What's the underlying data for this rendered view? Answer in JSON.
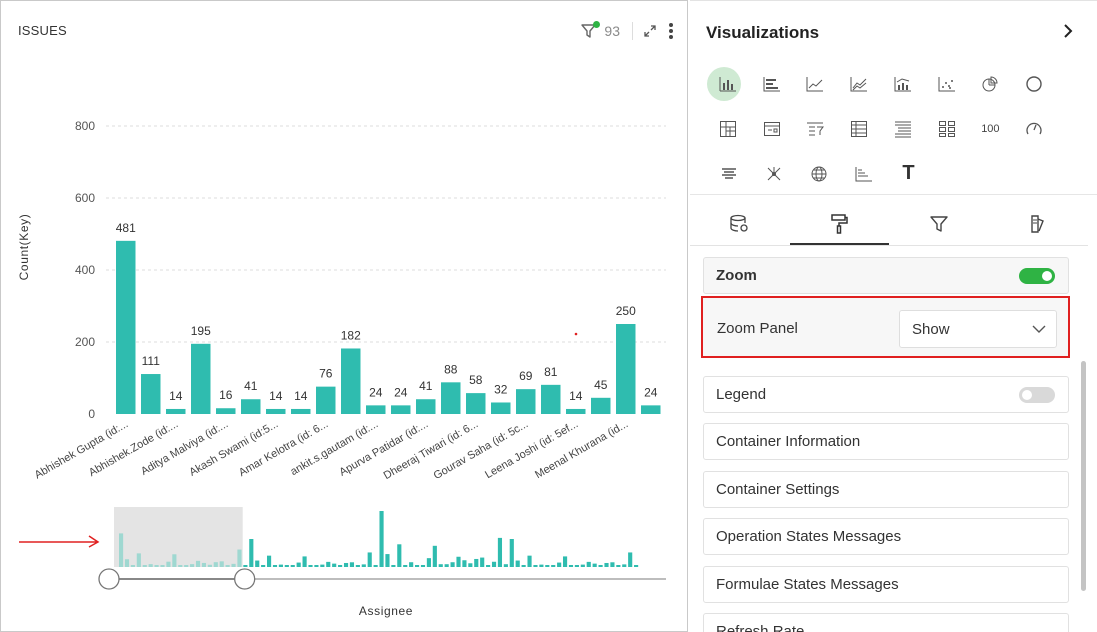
{
  "chart_panel": {
    "title": "ISSUES",
    "filter_count": "93"
  },
  "chart_data": {
    "type": "bar",
    "xlabel": "Assignee",
    "ylabel": "Count(Key)",
    "ylim": [
      0,
      800
    ],
    "yticks": [
      0,
      200,
      400,
      600,
      800
    ],
    "grid": true,
    "color": "#2fbcaf",
    "categories": [
      "Abhishek Gupta (id:...",
      "",
      "Abhishek.Zode (id:...",
      "",
      "Aditya Malviya (id:...",
      "",
      "Akash Swami (id:5...",
      "",
      "Amar Kelotra (id: 6...",
      "",
      "ankit.s.gautam (id:...",
      "",
      "Apurva Patidar (id:...",
      "",
      "Dheeraj Tiwari (id: 6...",
      "",
      "Gourav Saha (id: 5c...",
      "",
      "Leena Joshi (id: 5ef...",
      "",
      "Meenal Khurana (id...",
      ""
    ],
    "values": [
      481,
      111,
      14,
      195,
      16,
      41,
      14,
      14,
      76,
      182,
      24,
      24,
      41,
      88,
      58,
      32,
      69,
      81,
      14,
      45,
      250,
      24
    ],
    "zoom_navigator": {
      "selection_start": 0.0,
      "selection_end": 0.24
    }
  },
  "viz_panel": {
    "title": "Visualizations",
    "chart_types": [
      [
        "bar-chart-icon",
        "horizontal-bar-icon",
        "line-chart-icon",
        "area-chart-icon",
        "combo-chart-icon",
        "scatter-chart-icon",
        "pie-chart-icon",
        "donut-chart-icon"
      ],
      [
        "pivot-icon",
        "card-icon",
        "filter-list-icon",
        "table-icon",
        "grouped-table-icon",
        "tiles-icon",
        "kpi-icon",
        "gauge-icon"
      ],
      [
        "funnel-bars-icon",
        "network-icon",
        "globe-icon",
        "step-chart-icon",
        "text-icon"
      ]
    ],
    "kpi_label": "100",
    "text_glyph": "T",
    "tabs": [
      "data-tab",
      "format-tab",
      "filter-tab",
      "theme-tab"
    ],
    "zoom_label": "Zoom",
    "zoom_on": true,
    "zoom_panel_label": "Zoom Panel",
    "zoom_panel_value": "Show",
    "legend_label": "Legend",
    "legend_on": false,
    "container_info": "Container Information",
    "container_settings": "Container Settings",
    "operation_states": "Operation States Messages",
    "formulae_states": "Formulae States Messages",
    "refresh_rate": "Refresh Rate"
  }
}
